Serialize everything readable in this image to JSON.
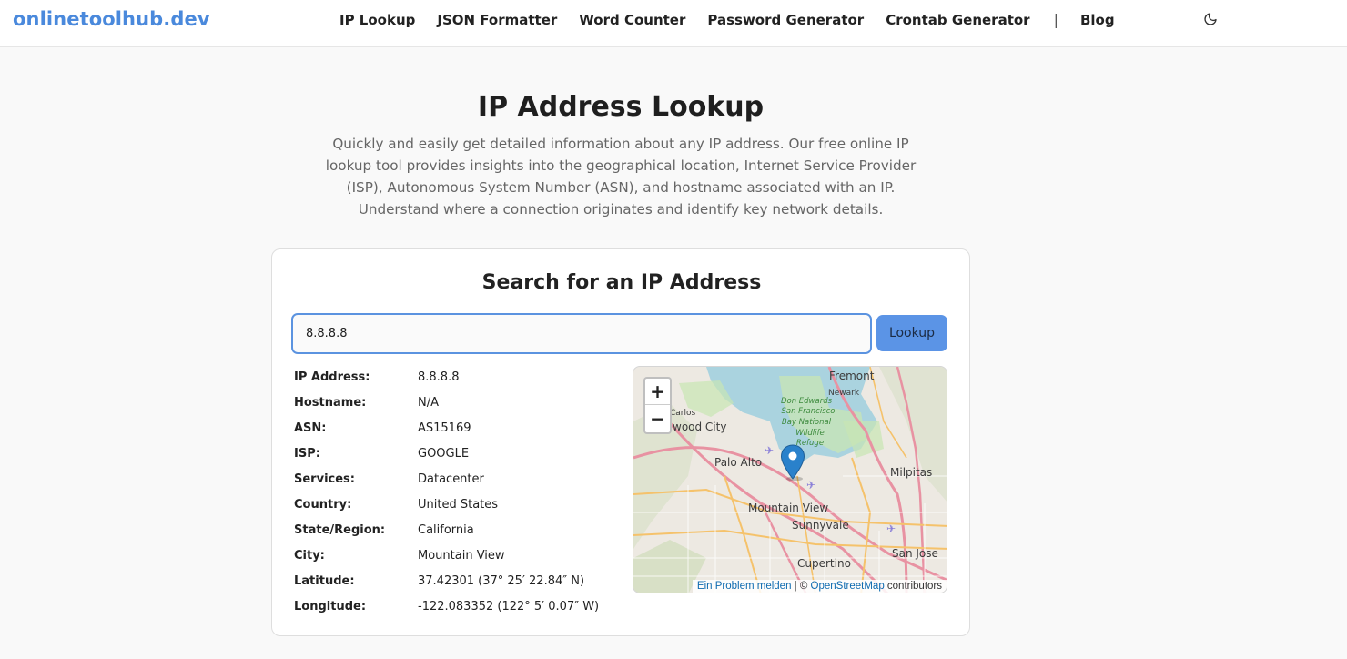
{
  "header": {
    "brand": "onlinetoolhub.dev",
    "nav": [
      {
        "label": "IP Lookup"
      },
      {
        "label": "JSON Formatter"
      },
      {
        "label": "Word Counter"
      },
      {
        "label": "Password Generator"
      },
      {
        "label": "Crontab Generator"
      }
    ],
    "separator": "|",
    "blog": "Blog",
    "theme_icon": "moon-icon"
  },
  "hero": {
    "title": "IP Address Lookup",
    "description": "Quickly and easily get detailed information about any IP address. Our free online IP lookup tool provides insights into the geographical location, Internet Service Provider (ISP), Autonomous System Number (ASN), and hostname associated with an IP. Understand where a connection originates and identify key network details."
  },
  "search": {
    "title": "Search for an IP Address",
    "input_value": "8.8.8.8",
    "button_label": "Lookup"
  },
  "details": [
    {
      "label": "IP Address:",
      "value": "8.8.8.8"
    },
    {
      "label": "Hostname:",
      "value": "N/A"
    },
    {
      "label": "ASN:",
      "value": "AS15169"
    },
    {
      "label": "ISP:",
      "value": "GOOGLE"
    },
    {
      "label": "Services:",
      "value": "Datacenter"
    },
    {
      "label": "Country:",
      "value": "United States"
    },
    {
      "label": "State/Region:",
      "value": "California"
    },
    {
      "label": "City:",
      "value": "Mountain View"
    },
    {
      "label": "Latitude:",
      "value": "37.42301 (37° 25′ 22.84″ N)"
    },
    {
      "label": "Longitude:",
      "value": "-122.083352 (122° 5′ 0.07″ W)"
    }
  ],
  "map": {
    "zoom_in": "+",
    "zoom_out": "−",
    "places": {
      "fremont": "Fremont",
      "newark": "Newark",
      "carlos": "Carlos",
      "redwood": "edwood City",
      "palo_alto": "Palo Alto",
      "milpitas": "Milpitas",
      "mountain_view": "Mountain View",
      "sunnyvale": "Sunnyvale",
      "cupertino": "Cupertino",
      "san_jose": "San Jose",
      "refuge_1": "Don Edwards",
      "refuge_2": "San Francisco",
      "refuge_3": "Bay National",
      "refuge_4": "Wildlife",
      "refuge_5": "Refuge"
    },
    "attribution": {
      "report": "Ein Problem melden",
      "divider": " | © ",
      "osm": "OpenStreetMap",
      "suffix": " contributors"
    },
    "colors": {
      "water": "#aad3df",
      "land": "#ede9e2",
      "park": "#c8e6b4",
      "motorway": "#e892a2",
      "primary": "#f5c26b",
      "pin": "#2a81cb"
    }
  }
}
